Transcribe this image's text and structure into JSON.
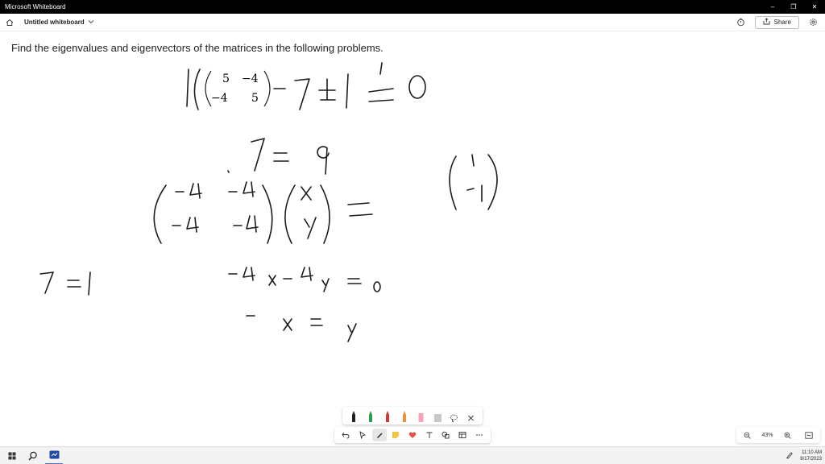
{
  "window": {
    "title": "Microsoft Whiteboard",
    "minimize_glyph": "–",
    "restore_glyph": "❐",
    "close_glyph": "✕"
  },
  "appbar": {
    "board_name": "Untitled whiteboard",
    "share_label": "Share",
    "icons": [
      "home-icon",
      "chevron-down-icon",
      "timer-icon",
      "share-icon",
      "gear-icon"
    ]
  },
  "canvas": {
    "problem_text": "Find the eigenvalues and eigenvectors of the matrices in the following problems.",
    "matrix": [
      [
        "5",
        "−4"
      ],
      [
        "−4",
        "5"
      ]
    ]
  },
  "pen_tray": {
    "pens": [
      {
        "name": "black-pen",
        "color": "#222222"
      },
      {
        "name": "green-pen",
        "color": "#2e9e4a"
      },
      {
        "name": "red-pen",
        "color": "#d23838"
      },
      {
        "name": "orange-pen",
        "color": "#ef8f3c"
      },
      {
        "name": "pink-highlighter",
        "color": "#f3a6b8"
      },
      {
        "name": "gray-eraser",
        "color": "#c8c8c8"
      }
    ],
    "icons": [
      "lasso-icon",
      "close-icon"
    ]
  },
  "toolbar": {
    "tools": [
      "undo-icon",
      "select-icon",
      "pen-icon",
      "sticky-note-icon",
      "reactions-icon",
      "text-icon",
      "shapes-icon",
      "templates-icon",
      "more-icon"
    ],
    "active_tool": "pen-icon",
    "colors": {
      "sticky": "#f4c542",
      "heart": "#e0534a"
    }
  },
  "zoom": {
    "level": "43%"
  },
  "taskbar": {
    "time": "11:10 AM",
    "date": "8/17/2023"
  }
}
